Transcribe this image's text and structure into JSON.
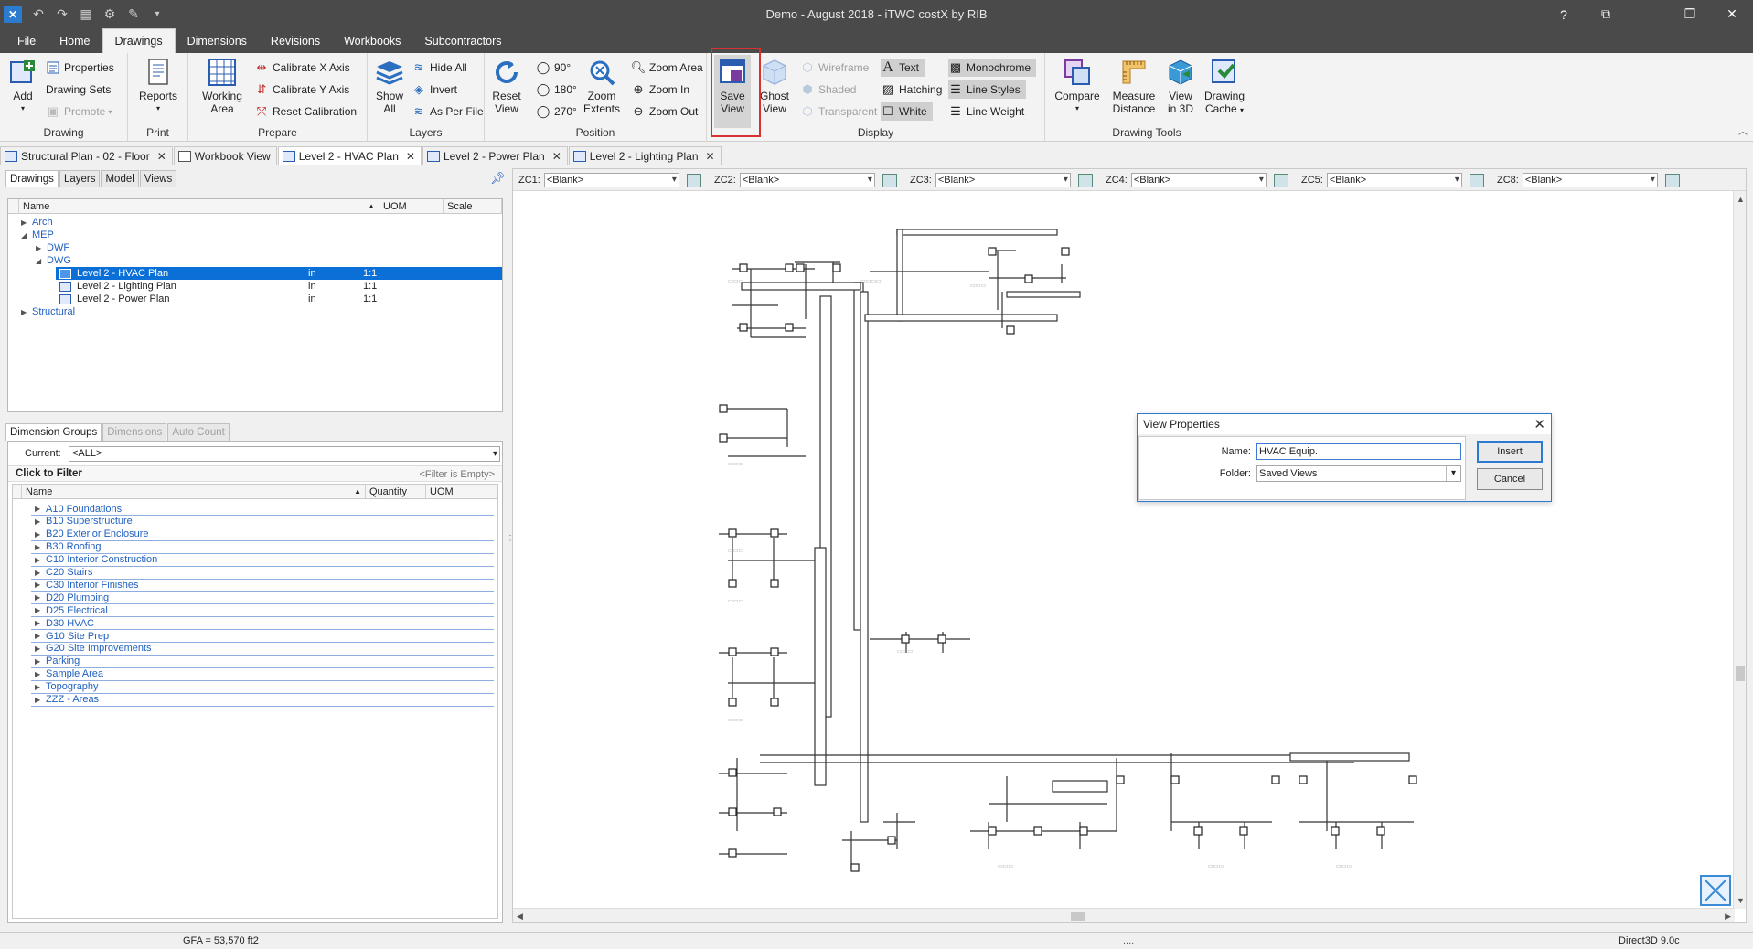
{
  "window": {
    "title": "Demo - August 2018 - iTWO costX by RIB",
    "controls": [
      "?",
      "⧉",
      "—",
      "❐",
      "✕"
    ]
  },
  "quick_access": [
    "app-icon",
    "undo-icon",
    "redo-icon",
    "grid-icon",
    "settings-icon",
    "tools-icon",
    "dropdown-icon"
  ],
  "ribbon_tabs": [
    "File",
    "Home",
    "Drawings",
    "Dimensions",
    "Revisions",
    "Workbooks",
    "Subcontractors"
  ],
  "active_ribbon_tab": "Drawings",
  "ribbon": {
    "drawing": {
      "label": "Drawing",
      "add": "Add",
      "properties": "Properties",
      "drawing_sets": "Drawing Sets",
      "promote": "Promote"
    },
    "print": {
      "label": "Print",
      "reports": "Reports"
    },
    "prepare": {
      "label": "Prepare",
      "working_area_1": "Working",
      "working_area_2": "Area",
      "calibrate_x": "Calibrate X Axis",
      "calibrate_y": "Calibrate Y Axis",
      "reset_calibration": "Reset Calibration"
    },
    "layers": {
      "label": "Layers",
      "show_all_1": "Show",
      "show_all_2": "All",
      "hide_all": "Hide All",
      "invert": "Invert",
      "as_per_file": "As Per File"
    },
    "position": {
      "label": "Position",
      "reset_view_1": "Reset",
      "reset_view_2": "View",
      "rot90": "90°",
      "rot180": "180°",
      "rot270": "270°",
      "zoom_extents_1": "Zoom",
      "zoom_extents_2": "Extents",
      "zoom_area": "Zoom Area",
      "zoom_in": "Zoom In",
      "zoom_out": "Zoom Out"
    },
    "display": {
      "label": "Display",
      "save_view_1": "Save",
      "save_view_2": "View",
      "ghost_view_1": "Ghost",
      "ghost_view_2": "View",
      "wireframe": "Wireframe",
      "shaded": "Shaded",
      "transparent": "Transparent",
      "text": "Text",
      "hatching": "Hatching",
      "white": "White",
      "monochrome": "Monochrome",
      "line_styles": "Line Styles",
      "line_weight": "Line Weight"
    },
    "drawing_tools": {
      "label": "Drawing Tools",
      "compare": "Compare",
      "measure_1": "Measure",
      "measure_2": "Distance",
      "view3d_1": "View",
      "view3d_2": "in 3D",
      "cache_1": "Drawing",
      "cache_2": "Cache"
    }
  },
  "document_tabs": [
    {
      "label": "Structural Plan - 02 - Floor",
      "active": false
    },
    {
      "label": "Workbook View",
      "active": false
    },
    {
      "label": "Level 2 - HVAC Plan",
      "active": true
    },
    {
      "label": "Level 2 - Power Plan",
      "active": false
    },
    {
      "label": "Level 2 - Lighting Plan",
      "active": false
    }
  ],
  "drawings_panel": {
    "tabs": [
      "Drawings",
      "Layers",
      "Model",
      "Views"
    ],
    "columns": [
      "Name",
      "UOM",
      "Scale"
    ],
    "tree": [
      {
        "label": "Arch",
        "level": 1,
        "uom": "",
        "scale": ""
      },
      {
        "label": "MEP",
        "level": 1,
        "uom": "",
        "scale": ""
      },
      {
        "label": "DWF",
        "level": 2,
        "uom": "",
        "scale": ""
      },
      {
        "label": "DWG",
        "level": 2,
        "uom": "",
        "scale": ""
      },
      {
        "label": "Level 2 - HVAC Plan",
        "level": 3,
        "uom": "in",
        "scale": "1:1",
        "selected": true
      },
      {
        "label": "Level 2 - Lighting Plan",
        "level": 3,
        "uom": "in",
        "scale": "1:1"
      },
      {
        "label": "Level 2 - Power Plan",
        "level": 3,
        "uom": "in",
        "scale": "1:1"
      },
      {
        "label": "Structural",
        "level": 1,
        "uom": "",
        "scale": ""
      }
    ]
  },
  "dimension_panel": {
    "tabs": [
      "Dimension Groups",
      "Dimensions",
      "Auto Count"
    ],
    "current_label": "Current:",
    "current_value": "<ALL>",
    "filter_label": "Click to Filter",
    "filter_hint": "<Filter is Empty>",
    "columns": [
      "Name",
      "Quantity",
      "UOM"
    ],
    "groups": [
      "A10 Foundations",
      "B10 Superstructure",
      "B20 Exterior Enclosure",
      "B30 Roofing",
      "C10 Interior Construction",
      "C20 Stairs",
      "C30 Interior Finishes",
      "D20 Plumbing",
      "D25 Electrical",
      "D30 HVAC",
      "G10 Site Prep",
      "G20 Site Improvements",
      "Parking",
      "Sample Area",
      "Topography",
      "ZZZ - Areas"
    ]
  },
  "zone_codes": [
    {
      "label": "ZC1:",
      "value": "<Blank>"
    },
    {
      "label": "ZC2:",
      "value": "<Blank>"
    },
    {
      "label": "ZC3:",
      "value": "<Blank>"
    },
    {
      "label": "ZC4:",
      "value": "<Blank>"
    },
    {
      "label": "ZC5:",
      "value": "<Blank>"
    },
    {
      "label": "ZC8:",
      "value": "<Blank>"
    }
  ],
  "dialog": {
    "title": "View Properties",
    "name_label": "Name:",
    "name_value": "HVAC Equip.",
    "folder_label": "Folder:",
    "folder_value": "Saved Views",
    "insert": "Insert",
    "cancel": "Cancel"
  },
  "status": {
    "gfa": "GFA = 53,570 ft2",
    "renderer": "Direct3D 9.0c"
  },
  "colors": {
    "titlebar": "#4a4a4a",
    "selection": "#0a6fd6",
    "link": "#1f5fbf",
    "highlight": "#d93030"
  }
}
